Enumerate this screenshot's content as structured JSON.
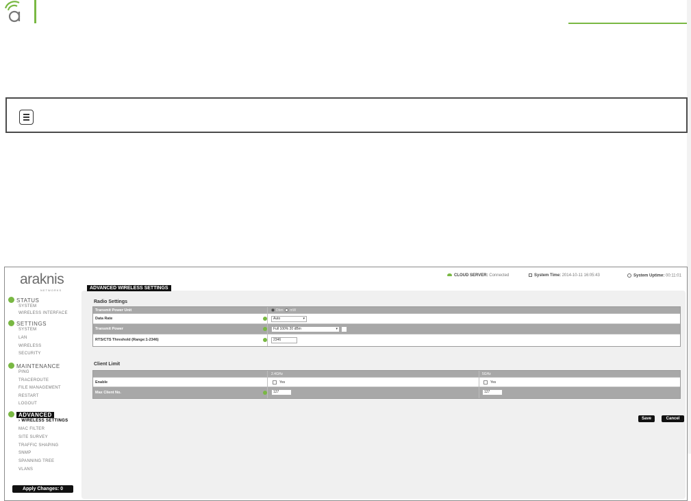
{
  "device": {
    "brand": "araknis",
    "brand_sub": "NETWORKS",
    "status_bar": {
      "cloud_label": "CLOUD SERVER:",
      "cloud_value": "Connected",
      "time_label": "System Time:",
      "time_value": "2014-10-11 16:05:43",
      "uptime_label": "System Uptime:",
      "uptime_value": "00:11:01"
    },
    "sidebar": {
      "sections": [
        {
          "label": "STATUS",
          "items": [
            "SYSTEM",
            "WIRELESS INTERFACE"
          ]
        },
        {
          "label": "SETTINGS",
          "items": [
            "SYSTEM",
            "LAN",
            "WIRELESS",
            "SECURITY"
          ]
        },
        {
          "label": "MAINTENANCE",
          "items": [
            "PING",
            "TRACEROUTE",
            "FILE MANAGEMENT",
            "RESTART",
            "LOGOUT"
          ]
        },
        {
          "label": "ADVANCED",
          "items": [
            "› WIRELESS SETTINGS",
            "MAC FILTER",
            "SITE SURVEY",
            "TRAFFIC SHAPING",
            "SNMP",
            "SPANNING TREE",
            "VLANS"
          ]
        }
      ],
      "apply_label": "Apply Changes: 0"
    },
    "page_title": "ADVANCED WIRELESS SETTINGS",
    "radio_settings": {
      "title": "Radio Settings",
      "power_unit_label": "Transmit Power Unit",
      "power_unit_options": [
        "Dbm",
        "mW"
      ],
      "data_rate_label": "Data Rate",
      "data_rate_value": "Auto",
      "tx_power_label": "Transmit Power",
      "tx_power_value": "Full 100% 20 dBm",
      "rts_label": "RTS/CTS Threshold (Range:1-2346)",
      "rts_value": "2346"
    },
    "client_limit": {
      "title": "Client Limit",
      "col_24": "2.4GHz",
      "col_5": "5GHz",
      "enable_label": "Enable",
      "yes_label": "Yes",
      "max_label": "Max Client No.",
      "max_24": "127",
      "max_5": "127"
    },
    "save_label": "Save",
    "cancel_label": "Cancel"
  }
}
